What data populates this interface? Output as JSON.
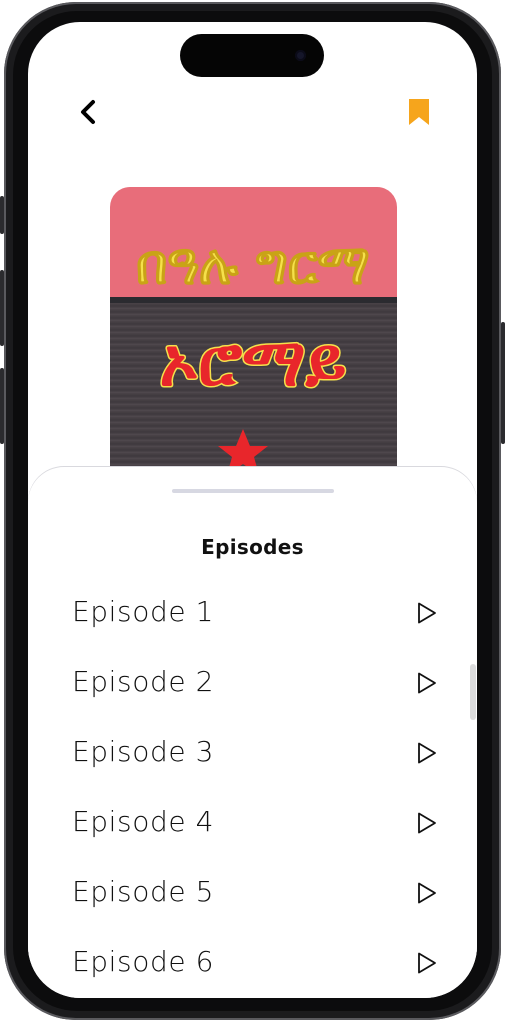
{
  "header": {
    "back_icon": "chevron-left-icon",
    "bookmark_icon": "bookmark-icon",
    "bookmark_color": "#f6a51c"
  },
  "cover": {
    "title_line1": "በዓሉ ግርማ",
    "title_line2": "ኦሮማይ",
    "top_color": "#e86d7a",
    "text_color": "#f5e04b",
    "star_color": "#e8262b"
  },
  "episodes": {
    "title": "Episodes",
    "play_icon": "play-icon",
    "items": [
      {
        "label": "Episode 1"
      },
      {
        "label": "Episode 2"
      },
      {
        "label": "Episode 3"
      },
      {
        "label": "Episode 4"
      },
      {
        "label": "Episode 5"
      },
      {
        "label": "Episode 6"
      }
    ]
  }
}
